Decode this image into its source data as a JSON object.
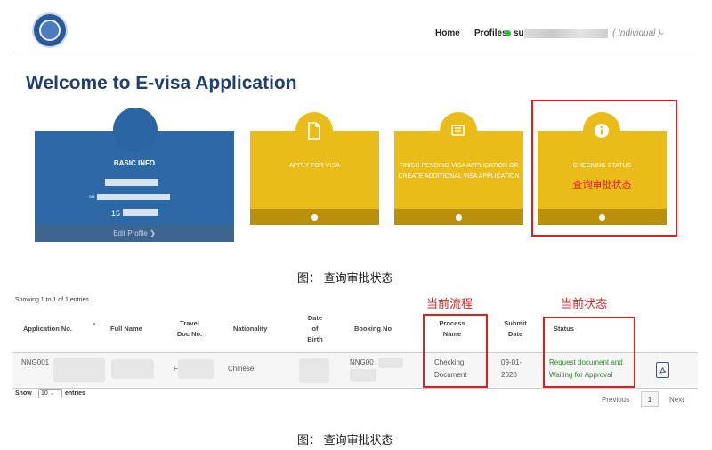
{
  "header": {
    "nav_home": "Home",
    "nav_profiles": "Profiles",
    "user_prefix": "su",
    "user_type": "( Individual )",
    "online_color": "#2ebc3a"
  },
  "page_title": "Welcome to E-visa Application",
  "cards": {
    "basic_info": {
      "title": "BASIC INFO",
      "user_prefix": "su",
      "phone_prefix": "15",
      "edit_label": "Edit Profile ❯"
    },
    "apply": {
      "title": "APPLY FOR VISA",
      "icon": "document-icon"
    },
    "finish": {
      "title": "FINISH PENDING VISA APPLICATION OR CREATE ADDITIONAL VISA APPLICATION",
      "icon": "book-icon"
    },
    "status": {
      "title": "CHECKING STATUS",
      "icon": "info-icon",
      "note": "查询审批状态"
    }
  },
  "caption_top": "图：  查询审批状态",
  "caption_bottom": "图：  查询审批状态",
  "annotations": {
    "process": "当前流程",
    "status": "当前状态"
  },
  "table": {
    "info": "Showing 1 to 1 of 1 entries",
    "headers": {
      "app_no": "Application No.",
      "full_name": "Full Name",
      "travel_doc": [
        "Travel",
        "Doc No."
      ],
      "nationality": "Nationality",
      "dob": [
        "Date",
        "of",
        "Birth"
      ],
      "booking": "Booking No",
      "process": [
        "Process",
        "Name"
      ],
      "submit": [
        "Submit",
        "Date"
      ],
      "status": "Status"
    },
    "row": {
      "app_no": "NNG001",
      "travel_doc": "F",
      "nationality": "Chinese",
      "booking": "NNG00",
      "process": [
        "Checking",
        "Document"
      ],
      "submit": [
        "09-01-",
        "2020"
      ],
      "status": [
        "Request document and",
        "Waiting for Approval"
      ]
    },
    "length_label_left": "Show",
    "length_value": "10",
    "length_label_right": "entries",
    "pagination": {
      "prev": "Previous",
      "page": "1",
      "next": "Next"
    }
  },
  "colors": {
    "blue_card": "#2d68a7",
    "yellow_card": "#e9bc1a",
    "annotation_red": "#e02020",
    "status_green": "#2a8b2a"
  }
}
